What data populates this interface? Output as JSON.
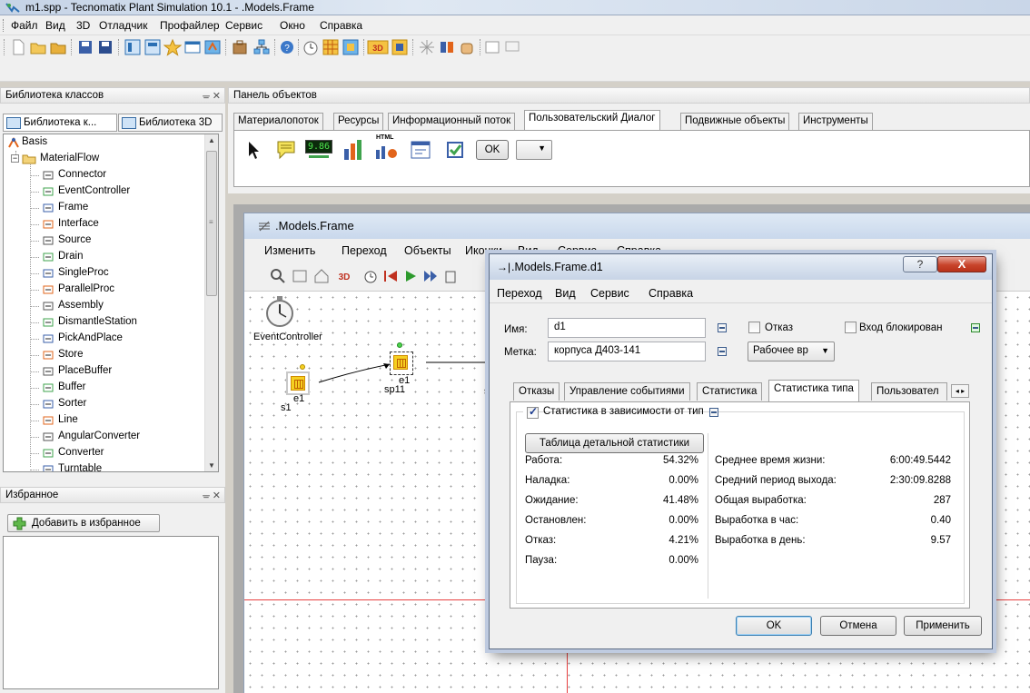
{
  "window": {
    "title": "m1.spp - Tecnomatix Plant Simulation 10.1 - .Models.Frame"
  },
  "menubar": {
    "items": [
      "Файл",
      "Вид",
      "3D",
      "Отладчик",
      "Профайлер",
      "Сервис",
      "Окно",
      "Справка"
    ]
  },
  "class_library": {
    "header": "Библиотека классов",
    "tabs": [
      "Библиотека к...",
      "Библиотека 3D"
    ],
    "tree": [
      {
        "label": "Basis",
        "icon": "basis-icon",
        "level": 0
      },
      {
        "label": "MaterialFlow",
        "icon": "folder-icon",
        "level": 1
      },
      {
        "label": "Connector",
        "icon": "connector-icon",
        "level": 2
      },
      {
        "label": "EventController",
        "icon": "eventcontroller-icon",
        "level": 2
      },
      {
        "label": "Frame",
        "icon": "frame-icon",
        "level": 2
      },
      {
        "label": "Interface",
        "icon": "interface-icon",
        "level": 2
      },
      {
        "label": "Source",
        "icon": "source-icon",
        "level": 2
      },
      {
        "label": "Drain",
        "icon": "drain-icon",
        "level": 2
      },
      {
        "label": "SingleProc",
        "icon": "singleproc-icon",
        "level": 2
      },
      {
        "label": "ParallelProc",
        "icon": "parallelproc-icon",
        "level": 2
      },
      {
        "label": "Assembly",
        "icon": "assembly-icon",
        "level": 2
      },
      {
        "label": "DismantleStation",
        "icon": "dismantle-icon",
        "level": 2
      },
      {
        "label": "PickAndPlace",
        "icon": "pickandplace-icon",
        "level": 2
      },
      {
        "label": "Store",
        "icon": "store-icon",
        "level": 2
      },
      {
        "label": "PlaceBuffer",
        "icon": "placebuffer-icon",
        "level": 2
      },
      {
        "label": "Buffer",
        "icon": "buffer-icon",
        "level": 2
      },
      {
        "label": "Sorter",
        "icon": "sorter-icon",
        "level": 2
      },
      {
        "label": "Line",
        "icon": "line-icon",
        "level": 2
      },
      {
        "label": "AngularConverter",
        "icon": "angularconverter-icon",
        "level": 2
      },
      {
        "label": "Converter",
        "icon": "converter-icon",
        "level": 2
      },
      {
        "label": "Turntable",
        "icon": "turntable-icon",
        "level": 2
      }
    ]
  },
  "favorites": {
    "header": "Избранное",
    "add_button": "Добавить в избранное"
  },
  "object_panel": {
    "header": "Панель объектов",
    "tabs": [
      "Материалопоток",
      "Ресурсы",
      "Информационный поток",
      "Пользовательский Диалог",
      "Подвижные объекты",
      "Инструменты"
    ],
    "active_tab": 3,
    "items": {
      "digital_display": "9.86",
      "html_label": "HTML",
      "ok_button": "OK"
    }
  },
  "frame_window": {
    "title": ".Models.Frame",
    "menu": [
      "Изменить",
      "Переход",
      "Объекты",
      "Иконки",
      "Вид",
      "Сервис",
      "Справка"
    ],
    "canvas": {
      "event_controller_label": "EventController",
      "nodes": [
        {
          "label": "s1",
          "sub": "e1"
        },
        {
          "label": "sp11",
          "sub": "e1"
        },
        {
          "label": "s",
          "sub": ""
        }
      ]
    }
  },
  "dialog": {
    "title": ".Models.Frame.d1",
    "help_label": "?",
    "close_label": "X",
    "menu": [
      "Переход",
      "Вид",
      "Сервис",
      "Справка"
    ],
    "name_label": "Имя:",
    "name_value": "d1",
    "tag_label": "Метка:",
    "tag_value": "корпуса Д403-141",
    "failure_label": "Отказ",
    "failure_checked": false,
    "entry_locked_label": "Вход блокирован",
    "entry_locked_checked": false,
    "work_time_label": "Рабочее вр",
    "tabs": [
      "Отказы",
      "Управление событиями",
      "Статистика",
      "Статистика типа",
      "Пользовател"
    ],
    "active_tab": 3,
    "type_stats_checkbox": "Статистика в зависимости от тип",
    "type_stats_checked": true,
    "detail_table_button": "Таблица детальной статистики",
    "left_stats": [
      {
        "label": "Работа:",
        "value": "54.32%"
      },
      {
        "label": "Наладка:",
        "value": "0.00%"
      },
      {
        "label": "Ожидание:",
        "value": "41.48%"
      },
      {
        "label": "Остановлен:",
        "value": "0.00%"
      },
      {
        "label": "Отказ:",
        "value": "4.21%"
      },
      {
        "label": "Пауза:",
        "value": "0.00%"
      }
    ],
    "right_stats": [
      {
        "label": "Среднее время жизни:",
        "value": "6:00:49.5442"
      },
      {
        "label": "Средний период выхода:",
        "value": "2:30:09.8288"
      },
      {
        "label": "Общая выработка:",
        "value": "287"
      },
      {
        "label": "Выработка в час:",
        "value": "0.40"
      },
      {
        "label": "Выработка в день:",
        "value": "9.57"
      }
    ],
    "buttons": {
      "ok": "OK",
      "cancel": "Отмена",
      "apply": "Применить"
    }
  },
  "colors": {
    "title_gradient": "#c9d6e8",
    "dialog_close": "#c8442b",
    "canvas_red_line": "#e84040"
  }
}
